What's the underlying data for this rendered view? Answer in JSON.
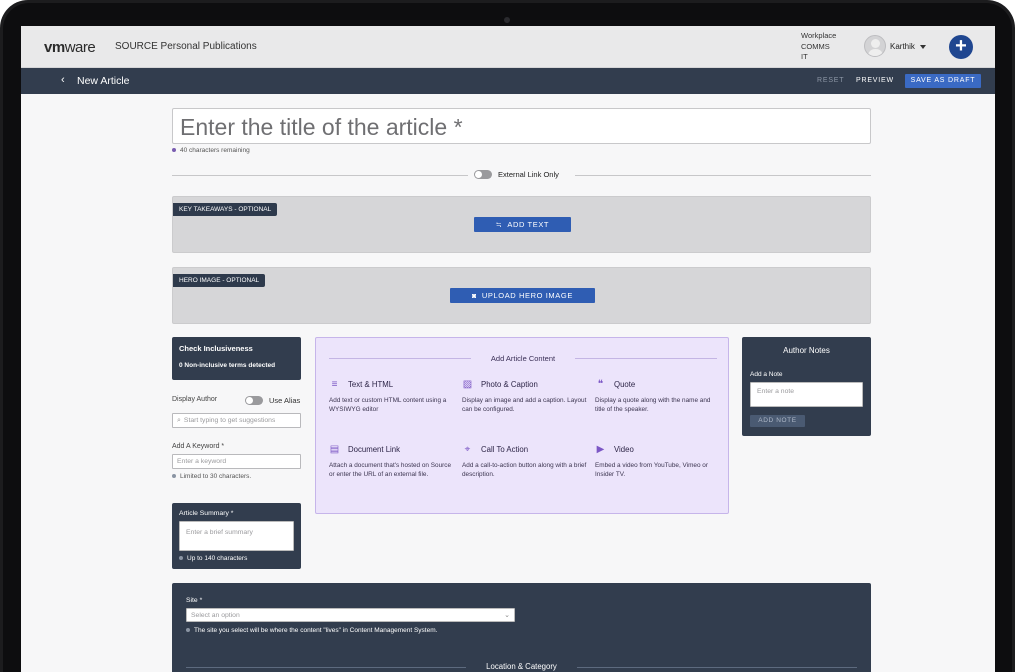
{
  "header": {
    "logo_bold": "vm",
    "logo_thin": "ware",
    "app_title": "SOURCE Personal Publications",
    "workplace_lines": [
      "Workplace",
      "COMMS",
      "IT"
    ],
    "user_name": "Karthik",
    "plus_label": "+"
  },
  "nav": {
    "back_label": "‹",
    "title": "New Article",
    "reset_label": "RESET",
    "preview_label": "PREVIEW",
    "draft_label": "SAVE AS DRAFT"
  },
  "article": {
    "title_placeholder": "Enter the title of the article *",
    "chars_remaining": "40 characters remaining",
    "external_link_label": "External Link Only"
  },
  "key_takeaways": {
    "tag": "KEY TAKEAWAYS - OPTIONAL",
    "button": "ADD TEXT",
    "button_icon": "≒"
  },
  "hero_image": {
    "tag": "HERO IMAGE - OPTIONAL",
    "button": "UPLOAD HERO IMAGE",
    "button_icon": "◙"
  },
  "inclusiveness": {
    "title": "Check Inclusiveness",
    "subtitle": "0 Non-inclusive terms detected"
  },
  "author": {
    "display_label": "Display Author",
    "alias_label": "Use Alias",
    "search_placeholder": "Start typing to get suggestions",
    "search_icon": "⌕"
  },
  "keyword": {
    "label": "Add A Keyword *",
    "placeholder": "Enter a keyword",
    "help": "Limited to 30 characters."
  },
  "summary": {
    "label": "Article Summary *",
    "placeholder": "Enter a brief summary",
    "help": "Up to 140 characters"
  },
  "content_panel": {
    "title": "Add Article Content",
    "items": [
      {
        "icon": "text-icon",
        "glyph": "≡",
        "title": "Text & HTML",
        "desc": "Add text or custom HTML content using a WYSIWYG editor"
      },
      {
        "icon": "image-icon",
        "glyph": "▨",
        "title": "Photo & Caption",
        "desc": "Display an image and add a caption. Layout can be configured."
      },
      {
        "icon": "quote-icon",
        "glyph": "❝",
        "title": "Quote",
        "desc": "Display a quote along with the name and title of the speaker."
      },
      {
        "icon": "document-icon",
        "glyph": "▤",
        "title": "Document Link",
        "desc": "Attach a document that's hosted on Source or enter the URL of an external file."
      },
      {
        "icon": "target-icon",
        "glyph": "⌖",
        "title": "Call To Action",
        "desc": "Add a call-to-action button along with a brief description."
      },
      {
        "icon": "video-icon",
        "glyph": "▶",
        "title": "Video",
        "desc": "Embed a video from YouTube, Vimeo or Insider TV."
      }
    ]
  },
  "author_notes": {
    "title": "Author Notes",
    "add_label": "Add a Note",
    "placeholder": "Enter a note",
    "button": "ADD NOTE"
  },
  "site": {
    "label": "Site *",
    "placeholder": "Select an option",
    "help": "The site you select will be where the content \"lives\" in Content Management System.",
    "section_title": "Location & Category"
  }
}
